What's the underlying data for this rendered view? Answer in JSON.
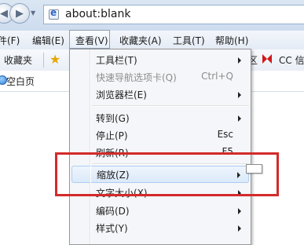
{
  "address_bar": {
    "url": "about:blank"
  },
  "menu_bar": {
    "items": [
      {
        "label": "件(F)"
      },
      {
        "label": "编辑(E)"
      },
      {
        "label": "查看(V)"
      },
      {
        "label": "收藏夹(A)"
      },
      {
        "label": "工具(T)"
      },
      {
        "label": "帮助(H)"
      }
    ]
  },
  "favorites_bar": {
    "label": "收藏夹",
    "right_fragment": "区",
    "cc_label": "CC 信"
  },
  "tab": {
    "label": "空白页"
  },
  "view_menu": {
    "items": [
      {
        "label": "工具栏(T)",
        "shortcut": ""
      },
      {
        "label": "快速导航选项卡(Q)",
        "shortcut": "Ctrl+Q"
      },
      {
        "label": "浏览器栏(E)",
        "shortcut": ""
      },
      {
        "label": "转到(G)",
        "shortcut": ""
      },
      {
        "label": "停止(P)",
        "shortcut": "Esc"
      },
      {
        "label": "刷新(R)",
        "shortcut": "F5"
      },
      {
        "label": "缩放(Z)",
        "shortcut": ""
      },
      {
        "label": "文字大小(X)",
        "shortcut": ""
      },
      {
        "label": "编码(D)",
        "shortcut": ""
      },
      {
        "label": "样式(Y)",
        "shortcut": ""
      }
    ]
  },
  "colors": {
    "annotation_red": "#d42a2a",
    "highlight_border": "#aecdf1"
  },
  "icons": [
    "back-icon",
    "forward-icon",
    "page-icon",
    "star-icon",
    "cc-icon",
    "tab-icon"
  ]
}
